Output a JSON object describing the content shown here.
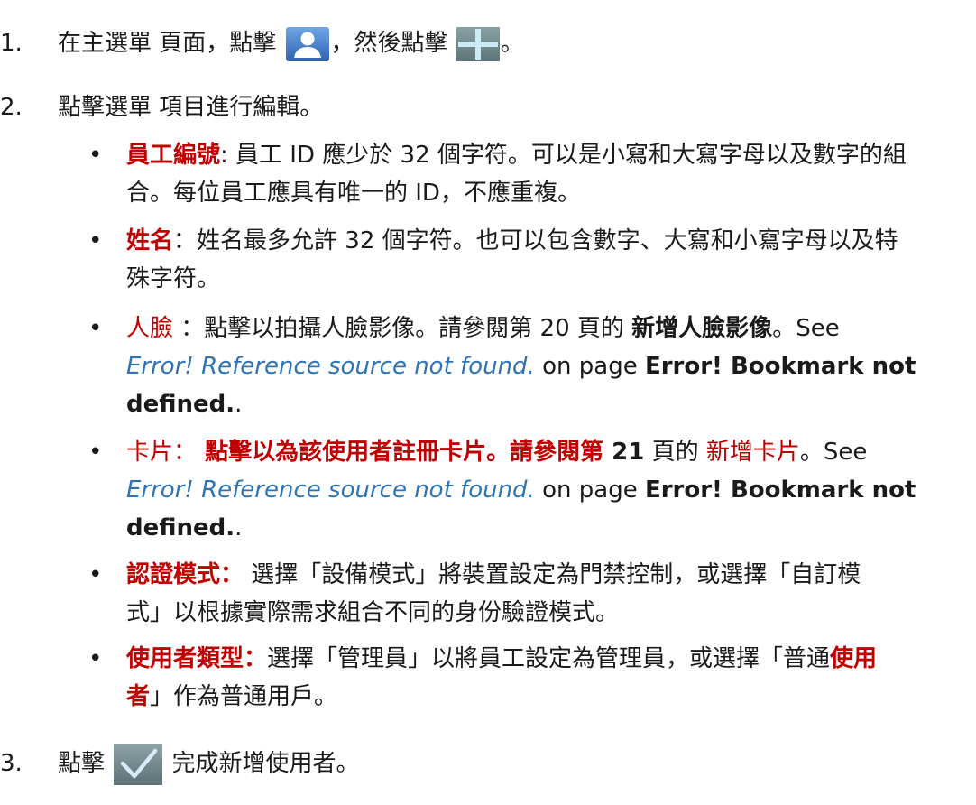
{
  "step1": {
    "num": "1.",
    "before_user_icon": "在主選單 頁面，點擊 ",
    "user_icon": "user-icon",
    "between": "，然後點擊 ",
    "plus_icon": "plus-icon",
    "after": "。"
  },
  "step2": {
    "num": "2.",
    "text": "點擊選單 項目進行編輯。"
  },
  "bullets": {
    "dot": "•",
    "emp_id": {
      "label": "員工編號",
      "line1": ": 員工 ID 應少於 32 個字符。可以是小寫和大寫字母以及數字的組",
      "line2": "合。每位員工應具有唯一的 ID，不應重複。"
    },
    "name": {
      "label": "姓名",
      "line1": "：姓名最多允許 32 個字符。也可以包含數字、大寫和小寫字母以及特",
      "line2": "殊字符。"
    },
    "face": {
      "label": "人臉",
      "text1": " ：點擊以拍攝人臉影像。請參閱第 20 頁的 ",
      "ref_title": "新增人臉影像",
      "text2": "。See",
      "err_ref": "Error! Reference source not found.",
      "on_page": " on page ",
      "err_bm": "Error! Bookmark not",
      "defined": "defined.",
      "tail": "."
    },
    "card": {
      "label": "卡片：",
      "text1": " 點擊以為該使用者註冊卡片。請參閱第 ",
      "page_num": "21",
      "text2": " 頁的 ",
      "ref_title": "新增卡片",
      "text3": "。See",
      "err_ref": "Error! Reference source not found.",
      "on_page": " on page ",
      "err_bm": "Error! Bookmark not",
      "defined": "defined.",
      "tail": "."
    },
    "auth": {
      "label": "認證模式：",
      "line1": " 選擇「設備模式」將裝置設定為門禁控制，或選擇「自訂模",
      "line2": "式」以根據實際需求組合不同的身份驗證模式。"
    },
    "user_type": {
      "label": "使用者類型：",
      "line1": "選擇「管理員」以將員工設定為管理員，或選擇「普通",
      "line1_red": "使用",
      "line2_red": "者",
      "line2": "」作為普通用戶。"
    }
  },
  "step3": {
    "num": "3.",
    "before_icon": "點擊 ",
    "check_icon": "check-icon",
    "after": " 完成新增使用者。"
  },
  "colors": {
    "text": "#1a1a1a",
    "label_red": "#c00000",
    "reference_blue": "#2e74b5",
    "icon_blue": "#3e74b8"
  }
}
